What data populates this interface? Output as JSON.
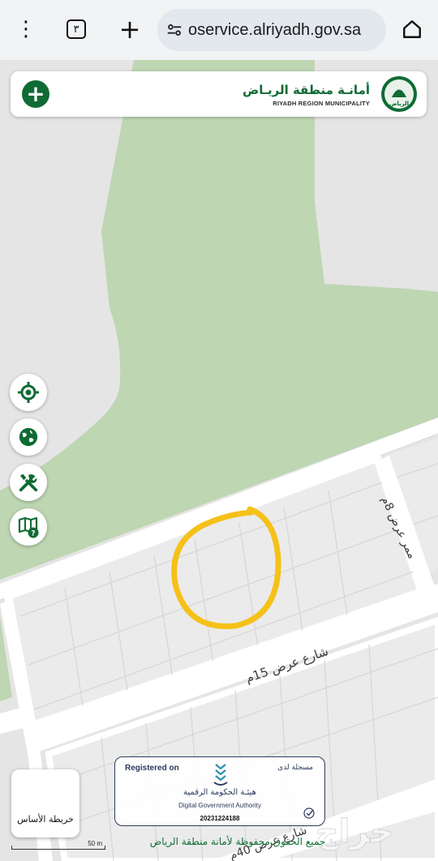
{
  "browser": {
    "url": "oservice.alriyadh.gov.sa",
    "tab_count": "٣"
  },
  "header": {
    "brand_ar": "أمانـة منطقة الريـاض",
    "brand_en": "RIYADH REGION MUNICIPALITY",
    "logo_text": "الرياض"
  },
  "tools": [
    "locate-icon",
    "globe-icon",
    "tools-icon",
    "map-help-icon"
  ],
  "map": {
    "street_1": "شارع عرض 15م",
    "street_2": "ممر عرض 8م",
    "street_3": "شارع عرض 40م",
    "scale_label": "50 m",
    "copyright": "جميع الحقوق محفوظة لأمانة منطقة الرياض",
    "colors": {
      "green_area": "#bed6b2",
      "gray_area": "#e4e4e4",
      "road": "#ffffff",
      "annotation": "#f5c118"
    }
  },
  "basemap_button": {
    "label": "خريطة الأساس"
  },
  "registration": {
    "registered_on": "Registered on",
    "registered_ar": "مسجلة لدى",
    "authority_ar": "هيئـة الحكومة الرقمية",
    "authority_en": "Digital Government Authority",
    "number": "20231224188"
  },
  "watermark": "حراج"
}
